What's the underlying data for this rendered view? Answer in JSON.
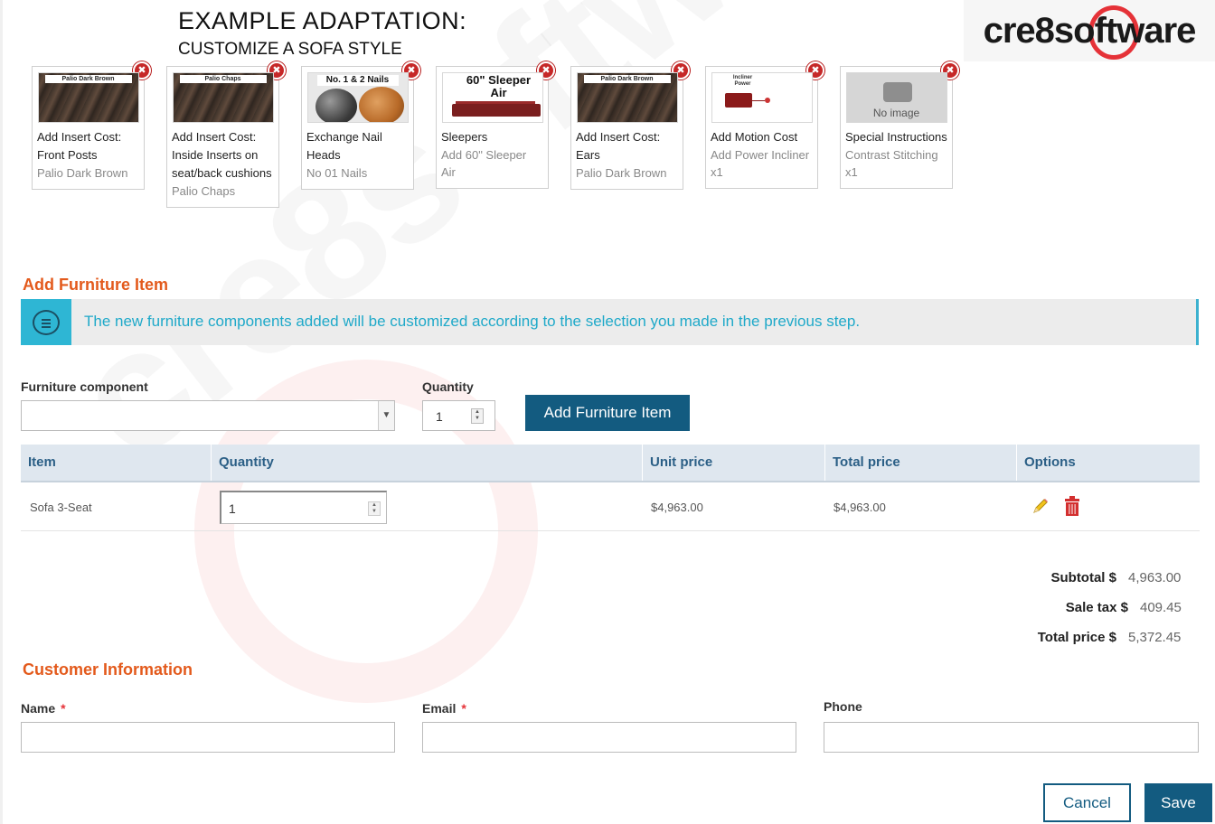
{
  "header": {
    "title": "EXAMPLE ADAPTATION:",
    "subtitle": "CUSTOMIZE A SOFA STYLE",
    "logo": "cre8software"
  },
  "components": [
    {
      "thumb_label": "Palio Dark Brown",
      "lines": [
        "Add Insert Cost:",
        "Front Posts"
      ],
      "value": "Palio Dark Brown"
    },
    {
      "thumb_label": "Palio Chaps",
      "lines": [
        "Add Insert Cost:",
        "Inside Inserts on",
        "seat/back cushions"
      ],
      "value": "Palio Chaps"
    },
    {
      "thumb_label": "No. 1 & 2 Nails",
      "lines": [
        "Exchange Nail",
        "Heads"
      ],
      "value": "No 01 Nails"
    },
    {
      "thumb_label": "60\" Sleeper Air",
      "lines": [
        "Sleepers"
      ],
      "value": "Add 60\" Sleeper Air"
    },
    {
      "thumb_label": "Palio Dark Brown",
      "lines": [
        "Add Insert Cost:",
        "Ears"
      ],
      "value": "Palio Dark Brown"
    },
    {
      "thumb_label": "Incliner Power",
      "lines": [
        "Add Motion Cost"
      ],
      "value": "Add Power Incliner",
      "value2": "x1"
    },
    {
      "thumb_label": "No image",
      "lines": [
        "Special Instructions"
      ],
      "value": "Contrast Stitching",
      "value2": "x1"
    }
  ],
  "remove_glyph": "✖",
  "add_section": {
    "title": "Add Furniture Item",
    "info": "The new furniture components added will be customized according to the selection you made in the previous step.",
    "component_label": "Furniture component",
    "component_value": "",
    "quantity_label": "Quantity",
    "quantity_value": "1",
    "add_button": "Add Furniture Item"
  },
  "table": {
    "headers": [
      "Item",
      "Quantity",
      "Unit price",
      "Total price",
      "Options"
    ],
    "rows": [
      {
        "item": "Sofa 3-Seat",
        "quantity": "1",
        "unit_price": "$4,963.00",
        "total_price": "$4,963.00"
      }
    ]
  },
  "totals": {
    "subtotal_label": "Subtotal $",
    "subtotal": "4,963.00",
    "tax_label": "Sale tax $",
    "tax": "409.45",
    "total_label": "Total price $",
    "total": "5,372.45"
  },
  "customer": {
    "title": "Customer Information",
    "name_label": "Name",
    "email_label": "Email",
    "phone_label": "Phone",
    "required_mark": "*",
    "name_value": "",
    "email_value": "",
    "phone_value": ""
  },
  "actions": {
    "cancel": "Cancel",
    "save": "Save"
  },
  "colors": {
    "accent": "#135b80",
    "section_title": "#e35a1c",
    "info": "#2eb6d4",
    "remove": "#c62828"
  }
}
